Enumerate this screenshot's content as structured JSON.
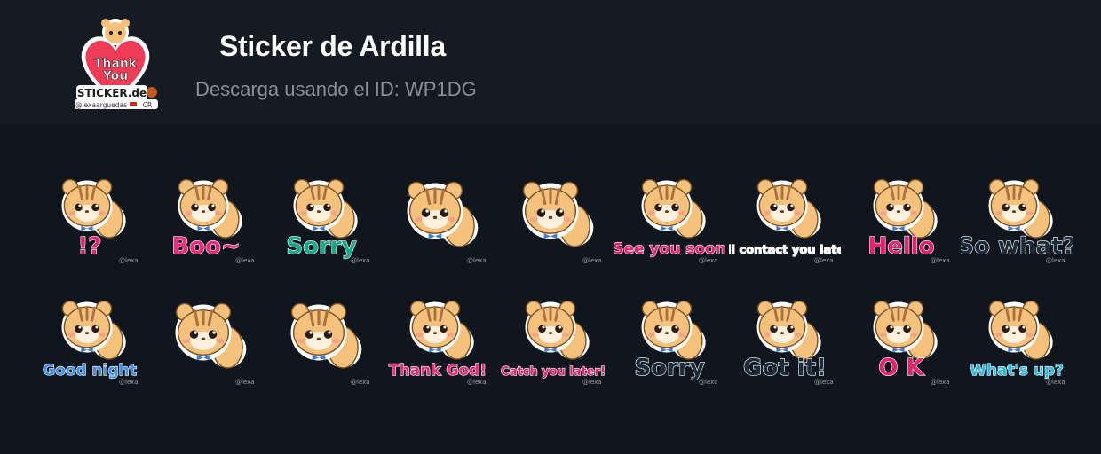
{
  "header": {
    "title": "Sticker de Ardilla",
    "subtitle": "Descarga usando el ID: WP1DG",
    "icon": {
      "name": "pack-icon",
      "line1": "Thank",
      "line2": "You",
      "brand": "STICKER.de",
      "handle": "@lexaarguedas",
      "country": "CR"
    }
  },
  "colors": {
    "background": "#0f161e",
    "header": "#141b23",
    "fur": "#f4c27d",
    "stripe": "#a8733f",
    "bow": "#3e7ad6"
  },
  "stickers": [
    {
      "name": "sticker-surprised",
      "text": "!?",
      "text_color": "#e4226e"
    },
    {
      "name": "sticker-boo",
      "text": "Boo~",
      "text_color": "#ec2b7d"
    },
    {
      "name": "sticker-sorry",
      "text": "Sorry",
      "text_color": "#1aa889"
    },
    {
      "name": "sticker-sparkle",
      "text": "",
      "text_color": "#ffffff"
    },
    {
      "name": "sticker-chair",
      "text": "",
      "text_color": "#ffffff"
    },
    {
      "name": "sticker-see-you-soon",
      "text": "See you soon",
      "text_color": "#e4226e"
    },
    {
      "name": "sticker-contact-you-later",
      "text": "I'll contact you later",
      "text_color": "#ffffff"
    },
    {
      "name": "sticker-hello",
      "text": "Hello",
      "text_color": "#e4226e"
    },
    {
      "name": "sticker-so-what",
      "text": "So what?",
      "text_color": "#1b2b3a"
    },
    {
      "name": "sticker-good-night",
      "text": "Good night",
      "text_color": "#3f8ee8"
    },
    {
      "name": "sticker-stars",
      "text": "",
      "text_color": "#ffffff"
    },
    {
      "name": "sticker-music",
      "text": "",
      "text_color": "#ffffff"
    },
    {
      "name": "sticker-thank-god",
      "text": "Thank God!",
      "text_color": "#ec2b7d"
    },
    {
      "name": "sticker-catch-you-later",
      "text": "Catch you later!",
      "text_color": "#e4226e"
    },
    {
      "name": "sticker-apple-sorry",
      "text": "Sorry",
      "text_color": "#1b2b3a"
    },
    {
      "name": "sticker-got-it",
      "text": "Got it!",
      "text_color": "#1b2b3a"
    },
    {
      "name": "sticker-ok",
      "text": "O K",
      "text_color": "#e4226e"
    },
    {
      "name": "sticker-whats-up",
      "text": "What's up?",
      "text_color": "#33b9e0"
    }
  ],
  "watermark": "@lexa"
}
